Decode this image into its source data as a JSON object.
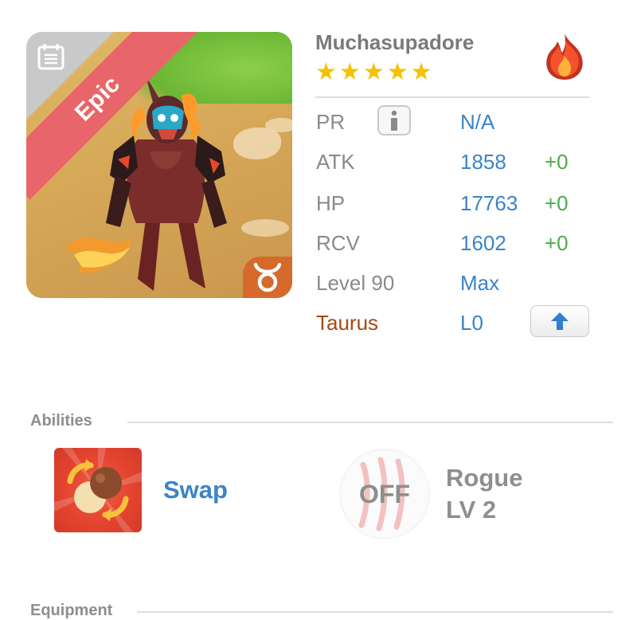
{
  "monster": {
    "name": "Muchasupadore",
    "stars": 5,
    "rarity": "Epic",
    "element_icon": "fire-icon",
    "zodiac_icon": "taurus-icon",
    "badge_icon": "calendar-icon"
  },
  "stats": {
    "pr": {
      "label": "PR",
      "value": "N/A"
    },
    "atk": {
      "label": "ATK",
      "value": "1858",
      "bonus": "+0"
    },
    "hp": {
      "label": "HP",
      "value": "17763",
      "bonus": "+0"
    },
    "rcv": {
      "label": "RCV",
      "value": "1602",
      "bonus": "+0"
    },
    "level": {
      "label": "Level 90",
      "value": "Max"
    },
    "zodiac": {
      "label": "Taurus",
      "value": "L0"
    }
  },
  "abilities": {
    "title": "Abilities",
    "items": [
      {
        "name": "Swap",
        "icon": "swap-icon"
      },
      {
        "name": "Rogue",
        "level": "LV 2",
        "status": "OFF",
        "icon": "claw-icon"
      }
    ]
  },
  "equipment": {
    "title": "Equipment"
  },
  "colors": {
    "accent_blue": "#3a84c9",
    "bonus_green": "#4bab49",
    "zodiac_brown": "#a64a12",
    "epic_red": "#e8666a",
    "star_gold": "#f5c100"
  }
}
